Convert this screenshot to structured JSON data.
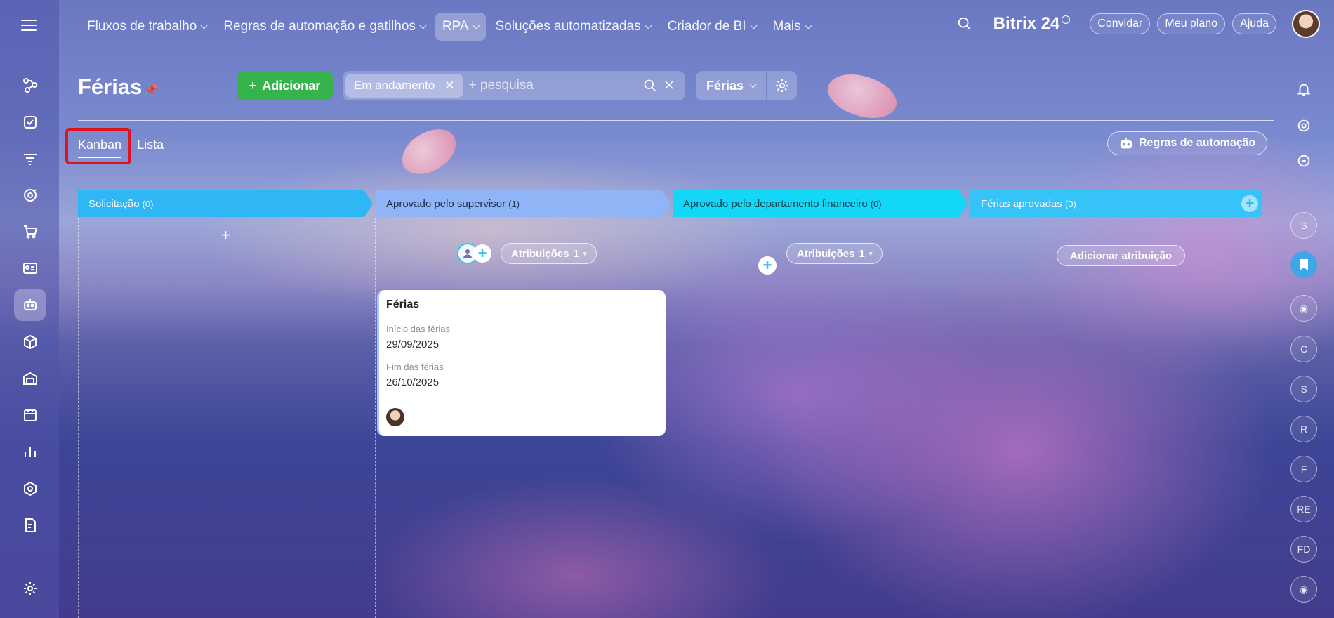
{
  "topbar": {
    "menu": [
      {
        "label": "Fluxos de trabalho",
        "active": false
      },
      {
        "label": "Regras de automação e gatilhos",
        "active": false
      },
      {
        "label": "RPA",
        "active": true
      },
      {
        "label": "Soluções automatizadas",
        "active": false
      },
      {
        "label": "Criador de BI",
        "active": false
      },
      {
        "label": "Mais",
        "active": false
      }
    ],
    "brand": "Bitrix 24",
    "invite_label": "Convidar",
    "plan_label": "Meu plano",
    "help_label": "Ajuda"
  },
  "page": {
    "title": "Férias",
    "add_label": "Adicionar",
    "filter_chip": "Em andamento",
    "search_placeholder": "+ pesquisa",
    "view_dropdown": "Férias",
    "tabs": [
      "Kanban",
      "Lista"
    ],
    "automation_rules_label": "Regras de automação"
  },
  "kanban": {
    "columns": [
      {
        "name": "Solicitação",
        "count": "(0)",
        "color": "#2fb7f5"
      },
      {
        "name": "Aprovado pelo supervisor",
        "count": "(1)",
        "color": "#8fb5f6"
      },
      {
        "name": "Aprovado pelo departamento financeiro",
        "count": "(0)",
        "color": "#12d7f7"
      },
      {
        "name": "Férias aprovadas",
        "count": "(0)",
        "color": "#36c3f7"
      }
    ],
    "assign_label": "Atribuições",
    "assign_count_col2": "1",
    "assign_count_col3": "1",
    "add_assignment_label": "Adicionar atribuição",
    "card": {
      "title": "Férias",
      "start_label": "Início das férias",
      "start_value": "29/09/2025",
      "end_label": "Fim das férias",
      "end_value": "26/10/2025"
    }
  },
  "rightbar": {
    "letters": [
      "S",
      "C",
      "S",
      "R",
      "F",
      "RE",
      "FD"
    ]
  }
}
